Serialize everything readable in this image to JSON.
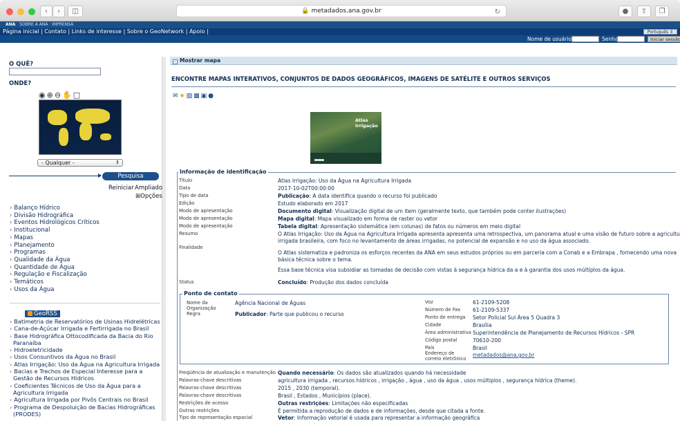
{
  "browser": {
    "url": "metadados.ana.gov.br"
  },
  "site": {
    "logo_text": "ANA",
    "brand_links": [
      "SOBRE A ANA",
      "IMPRENSA"
    ],
    "menu": "Página inicial | Contato | Links de interesse | Sobre o GeoNetwork | Apoio |",
    "language": "Português",
    "username_label": "Nome de usuário",
    "password_label": "Senha",
    "login_button": "Iniciar sessão"
  },
  "sidebar": {
    "what_label": "O QUÊ?",
    "where_label": "ONDE?",
    "region_select": "- Qualquer -",
    "search_button": "Pesquisa",
    "reset_link": "Reiniciar",
    "advanced_link": "Ampliado",
    "options_link": "⊞Opções",
    "categories": [
      "Balanço Hídrico",
      "Divisão Hidrográfica",
      "Eventos Hidrológicos Críticos",
      "Institucional",
      "Mapas",
      "Planejamento",
      "Programas",
      "Qualidade da Água",
      "Quantidade de Água",
      "Regulação e Fiscalização",
      "Temáticos",
      "Usos da Água"
    ],
    "rss_label": "GeoRSS",
    "rss_items": [
      "Batimetria de Reservatórios de Usinas Hidrelétricas",
      "Cana-de-Açúcar Irrigada e Fertirrigada no Brasil",
      "Base Hidrográfica Ottocodificada da Bacia do Rio Paranaíba",
      "Hidroeletricidade",
      "Usos Consuntivos da Água no Brasil",
      "Atlas Irrigação: Uso da Água na Agricultura Irrigada",
      "Bacias e Trechos de Especial Interesse para a Gestão de Recursos Hídricos",
      "Coeficientes Técnicos de Uso da Água para a Agricultura Irrigada",
      "Agricultura Irrigada por Pivôs Centrais no Brasil",
      "Programa de Despoluição de Bacias Hidrográficas (PRODES)"
    ]
  },
  "main": {
    "show_map": "Mostrar mapa",
    "heading": "ENCONTRE MAPAS INTERATIVOS, CONJUNTOS DE DADOS GEOGRÁFICOS, IMAGENS DE SATÉLITE E OUTROS SERVIÇOS",
    "thumbnail_title": "Atlas Irrigação",
    "id_legend": "Informação de identificação",
    "identification": {
      "titulo_k": "Título",
      "titulo_v": "Atlas Irrigação: Uso da Água na Agricultura Irrigada",
      "data_k": "Data",
      "data_v": "2017-10-02T00:00:00",
      "tipo_k": "Tipo de data",
      "tipo_b": "Publicação",
      "tipo_v": ": A data identifica quando o recurso foi publicado",
      "edicao_k": "Edição",
      "edicao_v": "Estudo elaborado em 2017",
      "modo1_k": "Modo de apresentação",
      "modo1_b": "Documento digital",
      "modo1_v": ": Visualização digital de um item (geralmente texto, que também pode conter ilustrações)",
      "modo2_k": "Modo de apresentação",
      "modo2_b": "Mapa digital",
      "modo2_v": ": Mapa visualizado em forma de raster ou vetor",
      "modo3_k": "Modo de apresentação",
      "modo3_b": "Tabela digital",
      "modo3_v": ": Apresentação sistemática (em colunas) de fatos ou números em meio digital",
      "resumo_k": "Resumo",
      "resumo_l1": "O Atlas Irrigação: Uso da Água na Agricultura Irrigada apresenta apresenta uma retrospectiva, um panorama atual e uma visão de futuro sobre a agricultura",
      "resumo_l2": "irrigada brasileira, com foco no levantamento de áreas irrigadas, no potencial de expansão e no uso da água associado.",
      "finalidade_k": "Finalidade",
      "final_l1": "O Atlas sistematiza e padroniza os esforços recentes da ANA em seus estudos próprios ou em parceria com a Conab e a Embrapa , fornecendo uma nova",
      "final_l2": "básica técnica sobre o tema.",
      "final_l3": "Essa base técnica visa subsidiar as tomadas de decisão com vistas à segurança hídrica da a e à garantia dos usos múltiplos da água.",
      "status_k": "Status",
      "status_b": "Concluído",
      "status_v": ": Produção dos dados concluída"
    },
    "contact_legend": "Ponto de contato",
    "contact": {
      "org_k": "Nome da Organização",
      "org_v": "Agência Nacional de Águas",
      "regra_k": "Regra",
      "regra_b": "Publicador",
      "regra_v": ": Parte que publicou o recurso",
      "voz_k": "Voz",
      "voz_v": "61-2109-5208",
      "fax_k": "Número de Fax",
      "fax_v": "61-2109-5337",
      "entrega_k": "Ponto de entrega",
      "entrega_v": "Setor Policial Sul Área 5 Quadra 3",
      "cidade_k": "Cidade",
      "cidade_v": "Brasília",
      "area_k": "Área administrativa",
      "area_v": "Superintendência de Planejamento de Recursos Hídricos - SPR",
      "cep_k": "Código postal",
      "cep_v": "70610-200",
      "pais_k": "País",
      "pais_v": "Brasil",
      "email_k": "Endereço de correio eletrônico",
      "email_v": "metadados@ana.gov.br"
    },
    "extra": {
      "freq_k": "Freqüência de atualização e manutenção",
      "freq_b": "Quando necessário",
      "freq_v": ": Os dados são atualizados quando há necessidade",
      "kw1_k": "Palavras-chave descritivas",
      "kw1_v": "agricultura irrigada , recursos hídricos , irrigação , água , uso da água , usos múltiplos , segurança hídrica (theme).",
      "kw2_k": "Palavras-chave descritivas",
      "kw2_v": "2015 , 2030 (temporal).",
      "kw3_k": "Palavras-chave descritivas",
      "kw3_v": "Brasil , Estados , Municípios (place).",
      "restr_k": "Restrições de acesso",
      "restr_b": "Outras restrições",
      "restr_v": ": Limitações não especificadas",
      "outras_k": "Outras restrições",
      "outras_v": "É permitida a reprodução de dados e de informações, desde que citada a fonte.",
      "tipo_k": "Tipo de representação espacial",
      "tipo_b": "Vetor",
      "tipo_v": ": Informação vetorial é usada para representar a informação geográfica"
    }
  }
}
